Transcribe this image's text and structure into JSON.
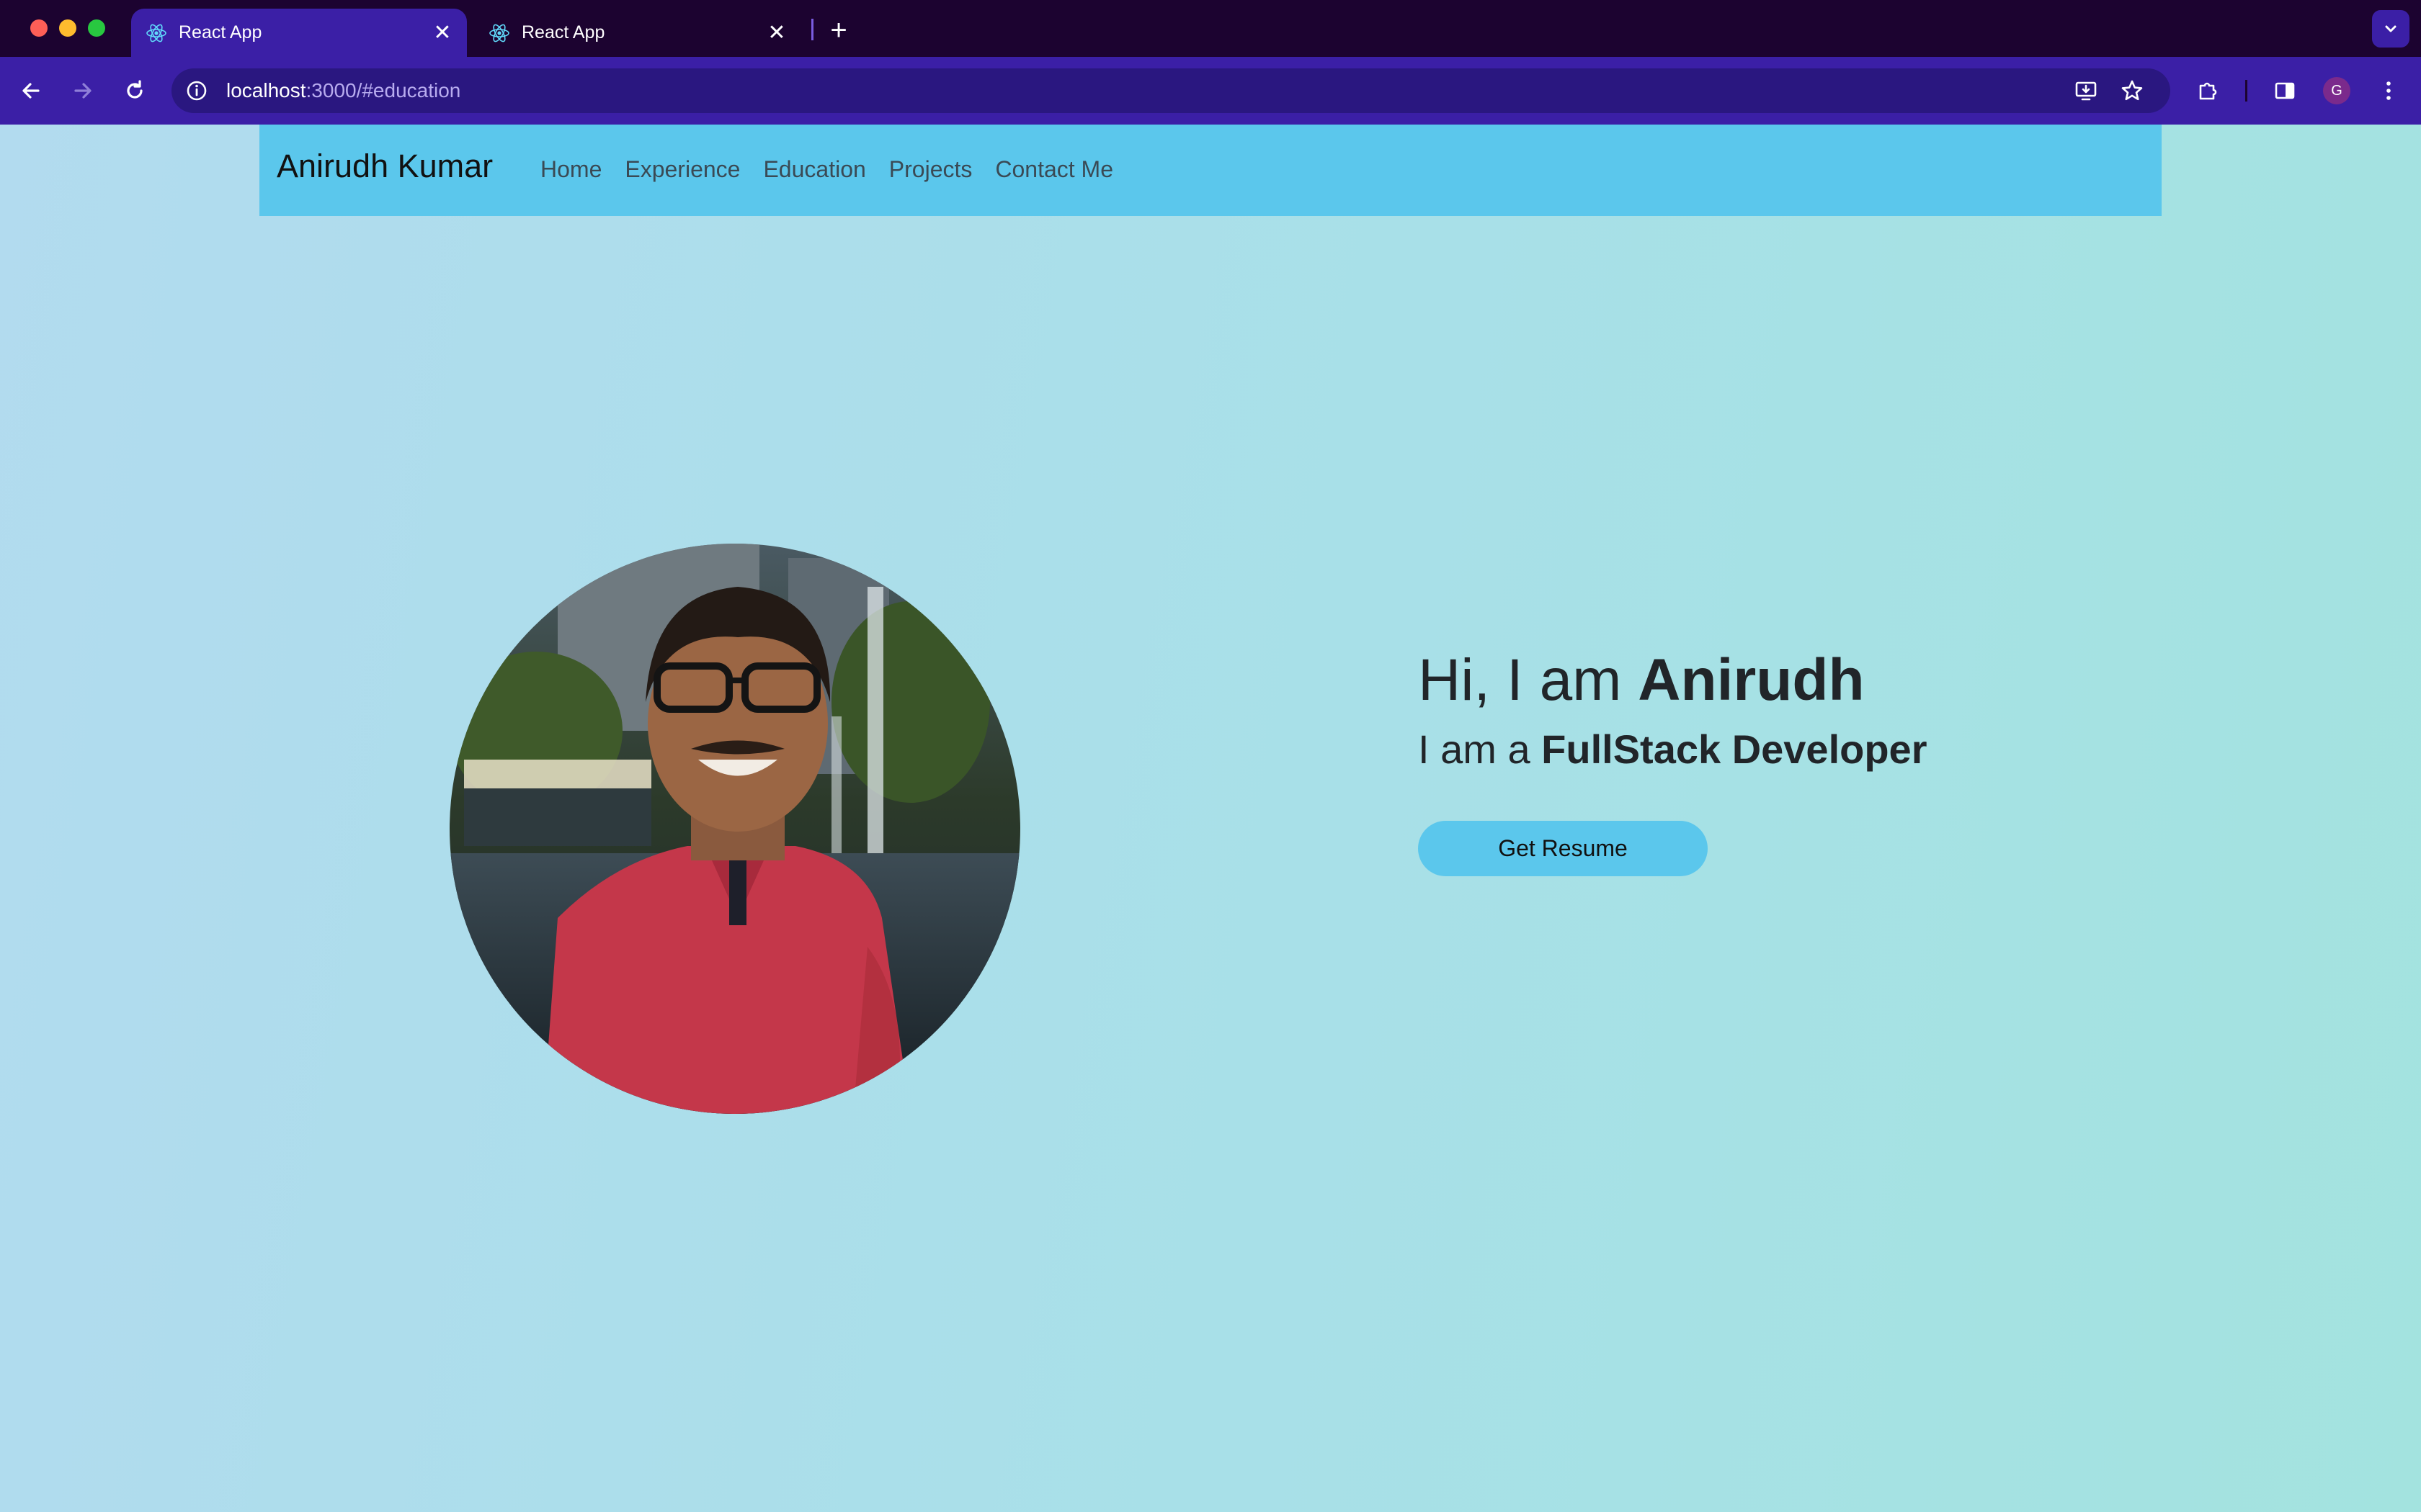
{
  "browser": {
    "tabs": [
      {
        "title": "React App",
        "active": true
      },
      {
        "title": "React App",
        "active": false
      }
    ],
    "url_host": "localhost",
    "url_rest": ":3000/#education",
    "profile_initial": "G",
    "accent_color": "#3b1fa6",
    "tabbar_color": "#1c0330"
  },
  "navbar": {
    "brand": "Anirudh Kumar",
    "links": [
      "Home",
      "Experience",
      "Education",
      "Projects",
      "Contact Me"
    ],
    "background_color": "#5bc7ec"
  },
  "hero": {
    "greeting_prefix": "Hi, I am ",
    "greeting_name": "Anirudh",
    "role_prefix": "I am a ",
    "role": "FullStack Developer",
    "button_label": "Get Resume"
  }
}
